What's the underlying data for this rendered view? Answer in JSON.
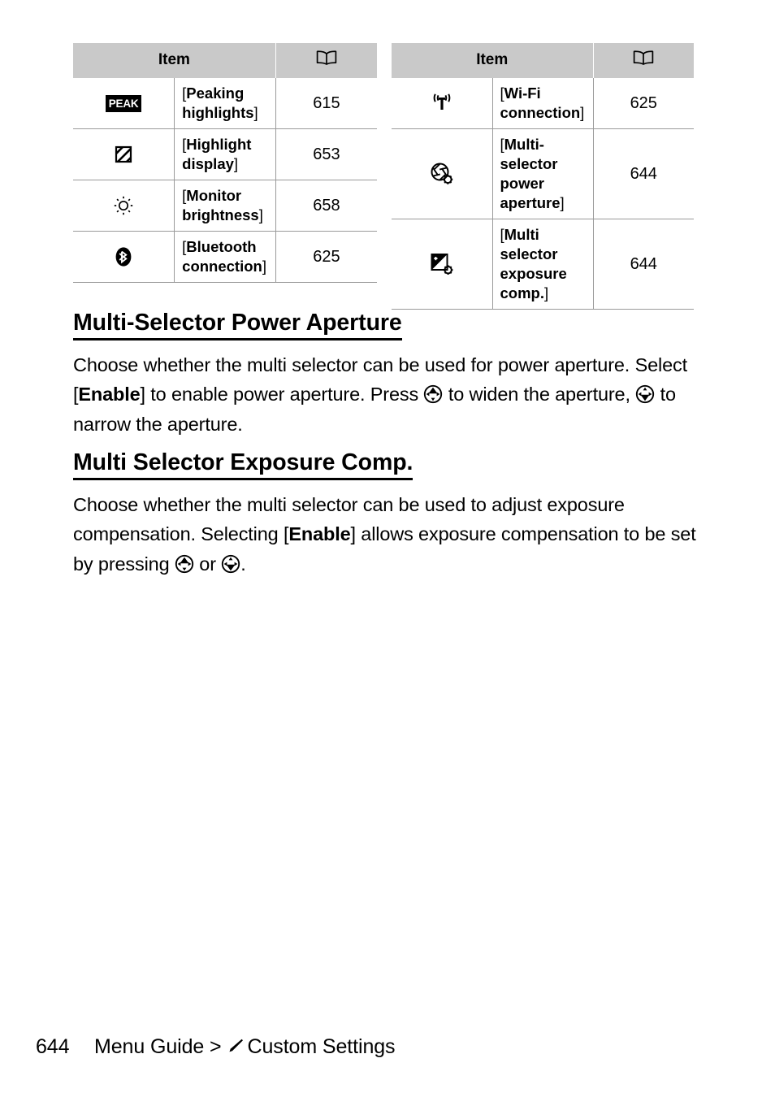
{
  "tables": [
    {
      "id": "left",
      "columns": {
        "item": "Item",
        "page_icon": "book-icon"
      },
      "rows": [
        {
          "icon": "peaking-highlights-icon",
          "icon_text": "PEAK",
          "name": "Peaking highlights",
          "page": "615"
        },
        {
          "icon": "highlight-display-icon",
          "icon_text": "",
          "name": "Highlight display",
          "page": "653"
        },
        {
          "icon": "monitor-brightness-icon",
          "icon_text": "",
          "name": "Monitor brightness",
          "page": "658"
        },
        {
          "icon": "bluetooth-connection-icon",
          "icon_text": "",
          "name": "Bluetooth connection",
          "page": "625"
        }
      ]
    },
    {
      "id": "right",
      "columns": {
        "item": "Item",
        "page_icon": "book-icon"
      },
      "rows": [
        {
          "icon": "wifi-connection-icon",
          "icon_text": "",
          "name": "Wi-Fi connection",
          "page": "625"
        },
        {
          "icon": "multi-selector-power-aperture-icon",
          "icon_text": "",
          "name": "Multi-selector power aperture",
          "page": "644"
        },
        {
          "icon": "multi-selector-exposure-comp-icon",
          "icon_text": "",
          "name": "Multi selector exposure comp.",
          "page": "644"
        }
      ]
    }
  ],
  "sections": [
    {
      "heading": "Multi-Selector Power Aperture",
      "body": {
        "p1": "Choose whether the multi selector can be used for power aperture. Select [",
        "b1": "Enable",
        "p2": "] to enable power aperture. Press ",
        "p3": " to widen the aperture, ",
        "p4": " to narrow the aperture."
      }
    },
    {
      "heading": "Multi Selector Exposure Comp.",
      "body": {
        "p1": "Choose whether the multi selector can be used to adjust exposure compensation. Selecting [",
        "b1": "Enable",
        "p2": "] allows exposure compensation to be set by pressing ",
        "p3": " or ",
        "p4": "."
      }
    }
  ],
  "footer": {
    "page_number": "644",
    "breadcrumb_prefix": "Menu Guide >",
    "breadcrumb_icon": "pencil-icon",
    "breadcrumb_suffix": "Custom Settings"
  },
  "colors": {
    "header_fill": "#c9c9c9",
    "rule": "#9a9a9a",
    "text": "#000000",
    "page_background": "#ffffff"
  }
}
